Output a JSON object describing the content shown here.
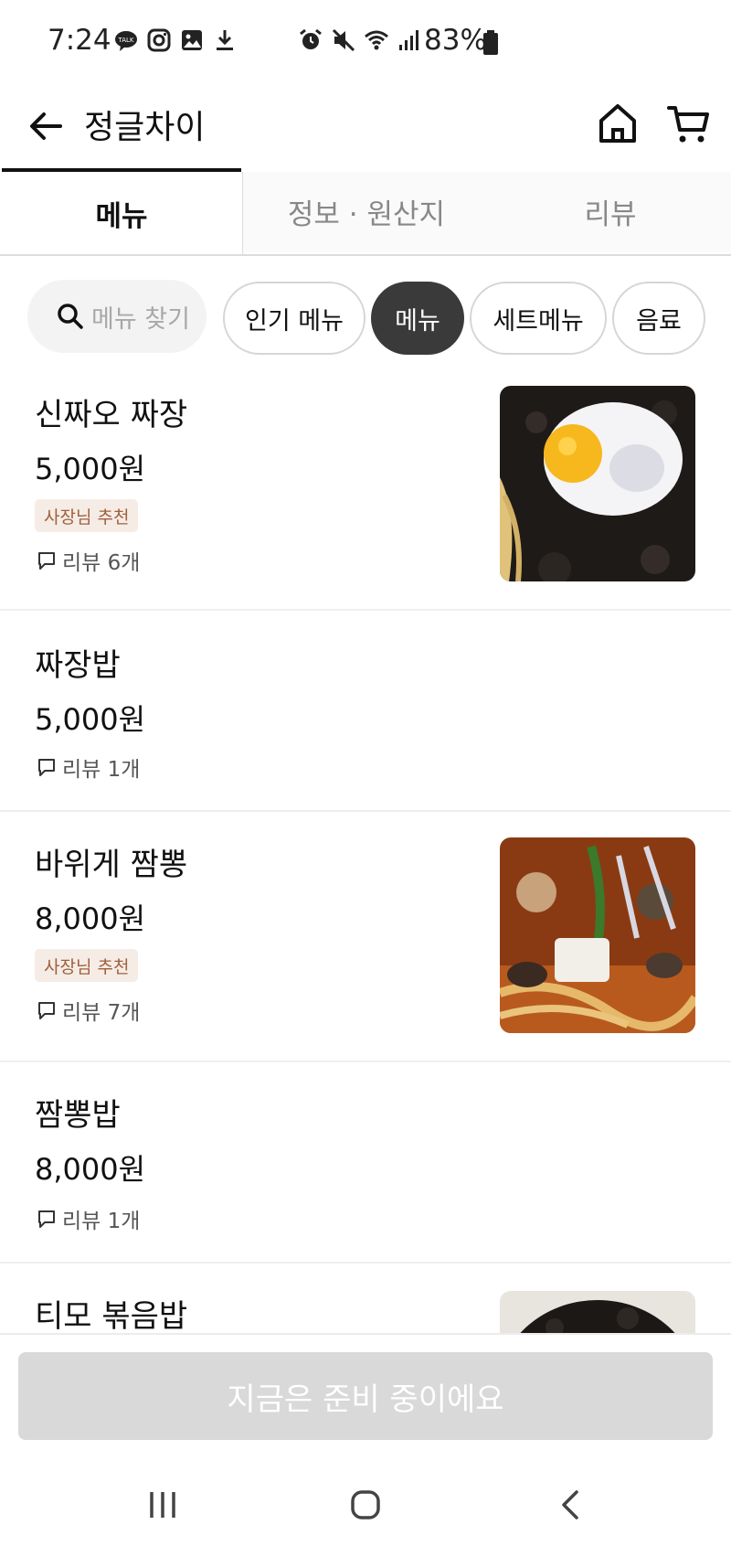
{
  "status_bar": {
    "time": "7:24",
    "battery": "83%"
  },
  "header": {
    "title": "정글차이"
  },
  "tabs": [
    {
      "label": "메뉴",
      "active": true
    },
    {
      "label": "정보 · 원산지",
      "active": false
    },
    {
      "label": "리뷰",
      "active": false
    }
  ],
  "filters": {
    "search_placeholder": "메뉴 찾기",
    "chips": [
      {
        "label": "인기 메뉴",
        "active": false
      },
      {
        "label": "메뉴",
        "active": true
      },
      {
        "label": "세트메뉴",
        "active": false
      },
      {
        "label": "음료",
        "active": false
      }
    ]
  },
  "menu_items": [
    {
      "name": "신짜오 짜장",
      "price": "5,000원",
      "badge": "사장님 추천",
      "review": "리뷰 6개",
      "image": "jjajang-with-fried-egg"
    },
    {
      "name": "짜장밥",
      "price": "5,000원",
      "badge": "",
      "review": "리뷰 1개",
      "image": ""
    },
    {
      "name": "바위게 짬뽕",
      "price": "8,000원",
      "badge": "사장님 추천",
      "review": "리뷰 7개",
      "image": "crab-jjamppong"
    },
    {
      "name": "짬뽕밥",
      "price": "8,000원",
      "badge": "",
      "review": "리뷰 1개",
      "image": ""
    },
    {
      "name": "티모 볶음밥",
      "price": "",
      "badge": "",
      "review": "",
      "image": "fried-rice"
    }
  ],
  "cta": {
    "label": "지금은 준비 중이에요"
  },
  "colors": {
    "accent_dark": "#3a3a3a",
    "badge_bg": "#f6ece6",
    "badge_text": "#a0603e",
    "cta_disabled": "#d9d9d9"
  }
}
